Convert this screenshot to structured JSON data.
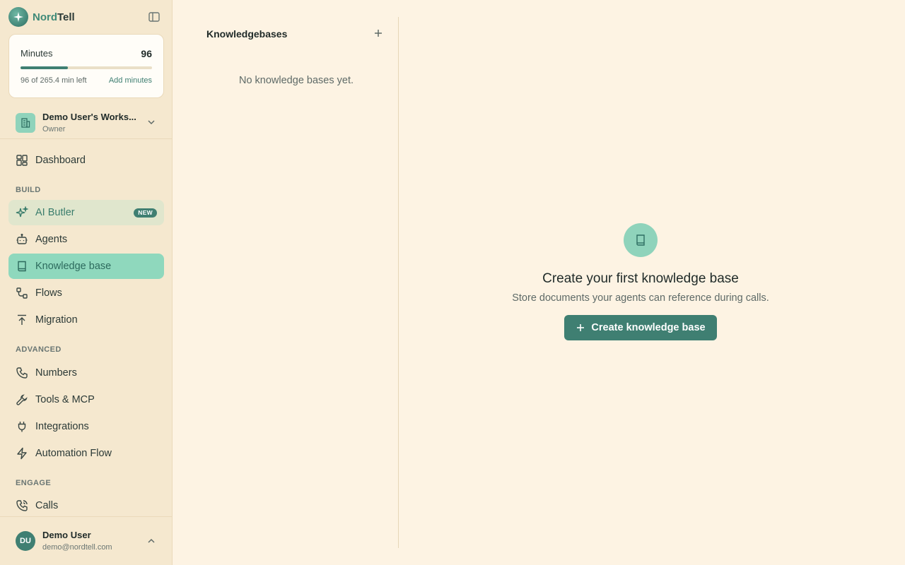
{
  "brand": {
    "name_part1": "Nord",
    "name_part2": "Tell"
  },
  "minutes": {
    "title": "Minutes",
    "value": "96",
    "progress_fraction": 0.362,
    "left_text": "96 of 265.4 min left",
    "add_label": "Add minutes"
  },
  "workspace": {
    "name": "Demo User's Works...",
    "role": "Owner"
  },
  "nav": {
    "dashboard": "Dashboard",
    "build_label": "BUILD",
    "ai_butler": "AI Butler",
    "new_badge": "NEW",
    "agents": "Agents",
    "knowledge_base": "Knowledge base",
    "flows": "Flows",
    "migration": "Migration",
    "advanced_label": "ADVANCED",
    "numbers": "Numbers",
    "tools_mcp": "Tools & MCP",
    "integrations": "Integrations",
    "automation_flow": "Automation Flow",
    "engage_label": "ENGAGE",
    "calls": "Calls"
  },
  "user": {
    "initials": "DU",
    "name": "Demo User",
    "email": "demo@nordtell.com"
  },
  "kb_panel": {
    "title": "Knowledgebases",
    "empty_text": "No knowledge bases yet."
  },
  "empty_state": {
    "title": "Create your first knowledge base",
    "subtitle": "Store documents your agents can reference during calls.",
    "button_label": "Create knowledge base"
  },
  "colors": {
    "accent": "#3f7f72",
    "active_bg": "#8fd8bd",
    "sidebar_bg": "#f5e8cf",
    "page_bg": "#fdf3e3"
  }
}
